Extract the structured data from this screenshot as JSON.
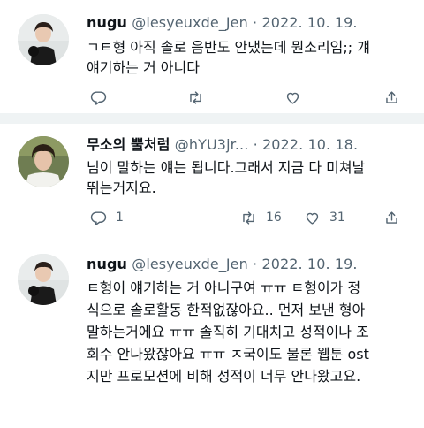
{
  "tweets": [
    {
      "name": "nugu",
      "handle": "@lesyeuxde_Jen",
      "dot": " · ",
      "date": "2022. 10. 19.",
      "text_lines": [
        "ㄱㅌ형 아직 솔로 음반도 안냈는데 뭔소리임;;  걔",
        "얘기하는 거 아니다"
      ],
      "reply_count": "",
      "retweet_count": "",
      "like_count": ""
    },
    {
      "name": "무소의 뿔처럼",
      "handle": "@hYU3jr...",
      "dot": " · ",
      "date": "2022. 10. 18.",
      "text_lines": [
        "님이 말하는 얘는 됩니다.그래서 지금 다 미쳐날",
        "뛰는거지요."
      ],
      "reply_count": "1",
      "retweet_count": "16",
      "like_count": "31"
    },
    {
      "name": "nugu",
      "handle": "@lesyeuxde_Jen",
      "dot": " · ",
      "date": "2022. 10. 19.",
      "text_lines": [
        "ㅌ형이 얘기하는 거 아니구여 ㅠㅠ ㅌ형이가  정",
        "식으로 솔로활동 한적없잖아요.. 먼저 보낸 형아",
        "말하는거에요 ㅠㅠ 솔직히 기대치고 성적이나 조",
        "회수 안나왔잖아요 ㅠㅠ ㅈ국이도 물론 웹툰 ost",
        "지만 프로모션에 비해 성적이 너무 안나왔고요."
      ]
    }
  ],
  "icons": {
    "reply": "reply-icon",
    "retweet": "retweet-icon",
    "like": "heart-icon",
    "share": "share-icon"
  },
  "colors": {
    "text": "#0f1419",
    "secondary": "#536471",
    "divider": "#eff3f4"
  }
}
